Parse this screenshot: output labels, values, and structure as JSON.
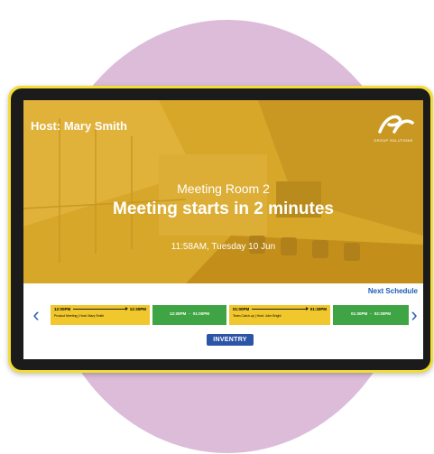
{
  "colors": {
    "background_circle": "#dcbcd9",
    "tablet_frame": "#f3dc35",
    "hero_overlay": "#d9a92a",
    "booked_slot": "#f0c72c",
    "free_slot": "#3fa544",
    "accent": "#2c55a8"
  },
  "header": {
    "host": "Host: Mary Smith",
    "logo_text": "GROUP SOLUTIONS"
  },
  "hero": {
    "room": "Meeting Room 2",
    "status": "Meeting starts in 2 minutes",
    "datetime": "11:58AM, Tuesday 10 Jun"
  },
  "schedule": {
    "title": "Next Schedule",
    "prev_icon": "chevron-left-icon",
    "next_icon": "chevron-right-icon",
    "slots": [
      {
        "start": "12:00PM",
        "end": "12:30PM",
        "meeting": "Product Meeting | Host: Mary Smith",
        "status": "booked"
      },
      {
        "start": "12:30PM",
        "end": "01:00PM",
        "meeting": "",
        "status": "free"
      },
      {
        "start": "01:00PM",
        "end": "01:30PM",
        "meeting": "Team Catch-up | Host: John Bright",
        "status": "booked"
      },
      {
        "start": "01:30PM",
        "end": "02:30PM",
        "meeting": "",
        "status": "free"
      }
    ]
  },
  "footer": {
    "brand": "INVENTRY"
  }
}
